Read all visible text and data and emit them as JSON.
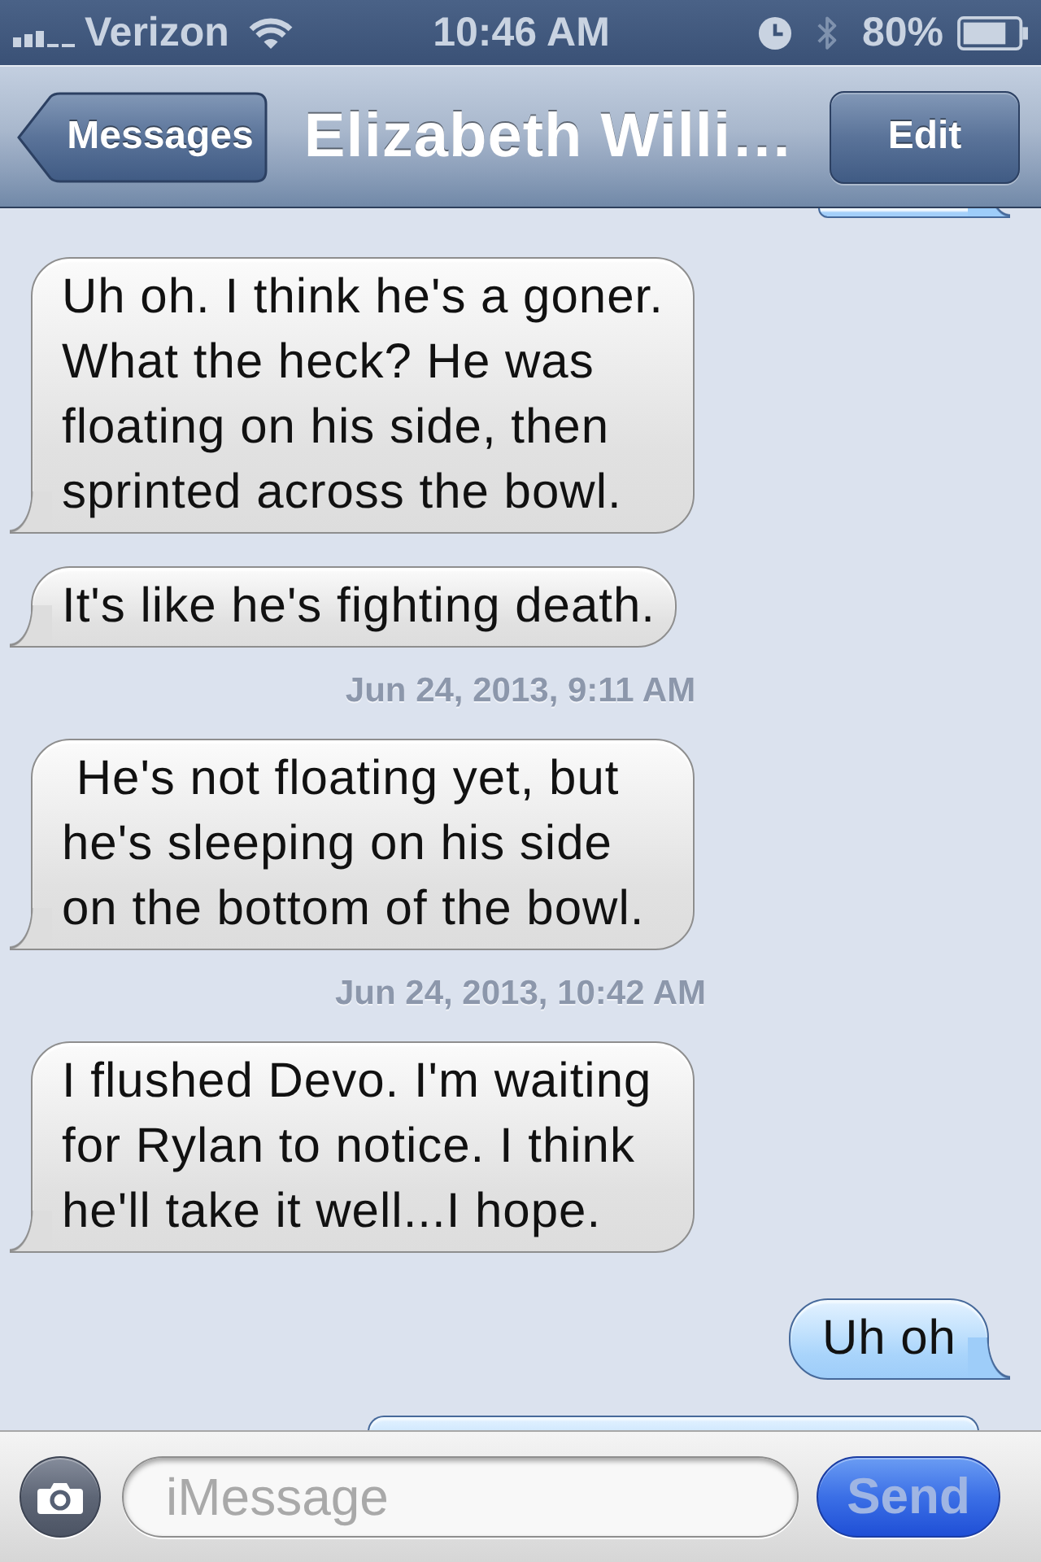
{
  "status_bar": {
    "carrier": "Verizon",
    "time": "10:46 AM",
    "battery": "80%"
  },
  "nav_bar": {
    "back_button": "Messages",
    "title": "Elizabeth Willi…",
    "edit_button": "Edit"
  },
  "thread": [
    {
      "kind": "clipped",
      "outgoing": true,
      "cut_at_top": true
    },
    {
      "kind": "received",
      "text": "Uh oh. I think he's a goner. What the heck? He was floating on his side, then sprinted across the bowl."
    },
    {
      "kind": "received",
      "text": "It's like he's fighting death."
    },
    {
      "kind": "timestamp",
      "text": "Jun 24, 2013, 9:11 AM"
    },
    {
      "kind": "received",
      "text": " He's not floating yet, but he's sleeping on his side on the bottom of the bowl."
    },
    {
      "kind": "timestamp",
      "text": "Jun 24, 2013, 10:42 AM"
    },
    {
      "kind": "received",
      "text": "I flushed Devo. I'm waiting for Rylan to notice. I think he'll take it well...I hope."
    },
    {
      "kind": "sent",
      "text": "Uh oh"
    },
    {
      "kind": "clipped",
      "outgoing": true,
      "cut_at_top": false
    }
  ],
  "compose_bar": {
    "placeholder": "iMessage",
    "send_button": {
      "label": "Send",
      "disabled": true
    }
  }
}
